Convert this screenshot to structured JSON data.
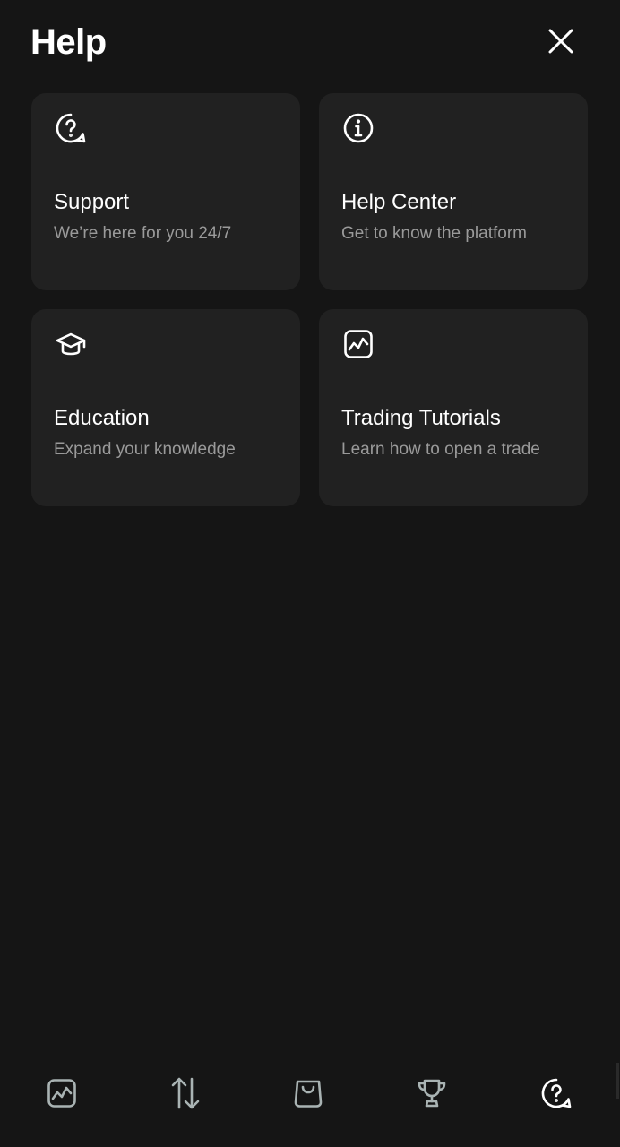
{
  "header": {
    "title": "Help"
  },
  "cards": [
    {
      "icon": "question-bubble-icon",
      "title": "Support",
      "subtitle": "We’re here for you 24/7"
    },
    {
      "icon": "info-icon",
      "title": "Help Center",
      "subtitle": "Get to know the platform"
    },
    {
      "icon": "graduation-cap-icon",
      "title": "Education",
      "subtitle": "Expand your knowledge"
    },
    {
      "icon": "chart-icon",
      "title": "Trading Tutorials",
      "subtitle": "Learn how to open a trade"
    }
  ],
  "bottom_nav": {
    "items": [
      {
        "icon": "chart-icon"
      },
      {
        "icon": "sort-arrows-icon"
      },
      {
        "icon": "shopping-bag-icon"
      },
      {
        "icon": "trophy-icon"
      },
      {
        "icon": "question-bubble-icon",
        "active": true
      }
    ]
  },
  "colors": {
    "background": "#151515",
    "card": "#212121",
    "text": "#ffffff",
    "muted": "#9a9a9a",
    "nav_inactive": "#a9b3b3"
  }
}
